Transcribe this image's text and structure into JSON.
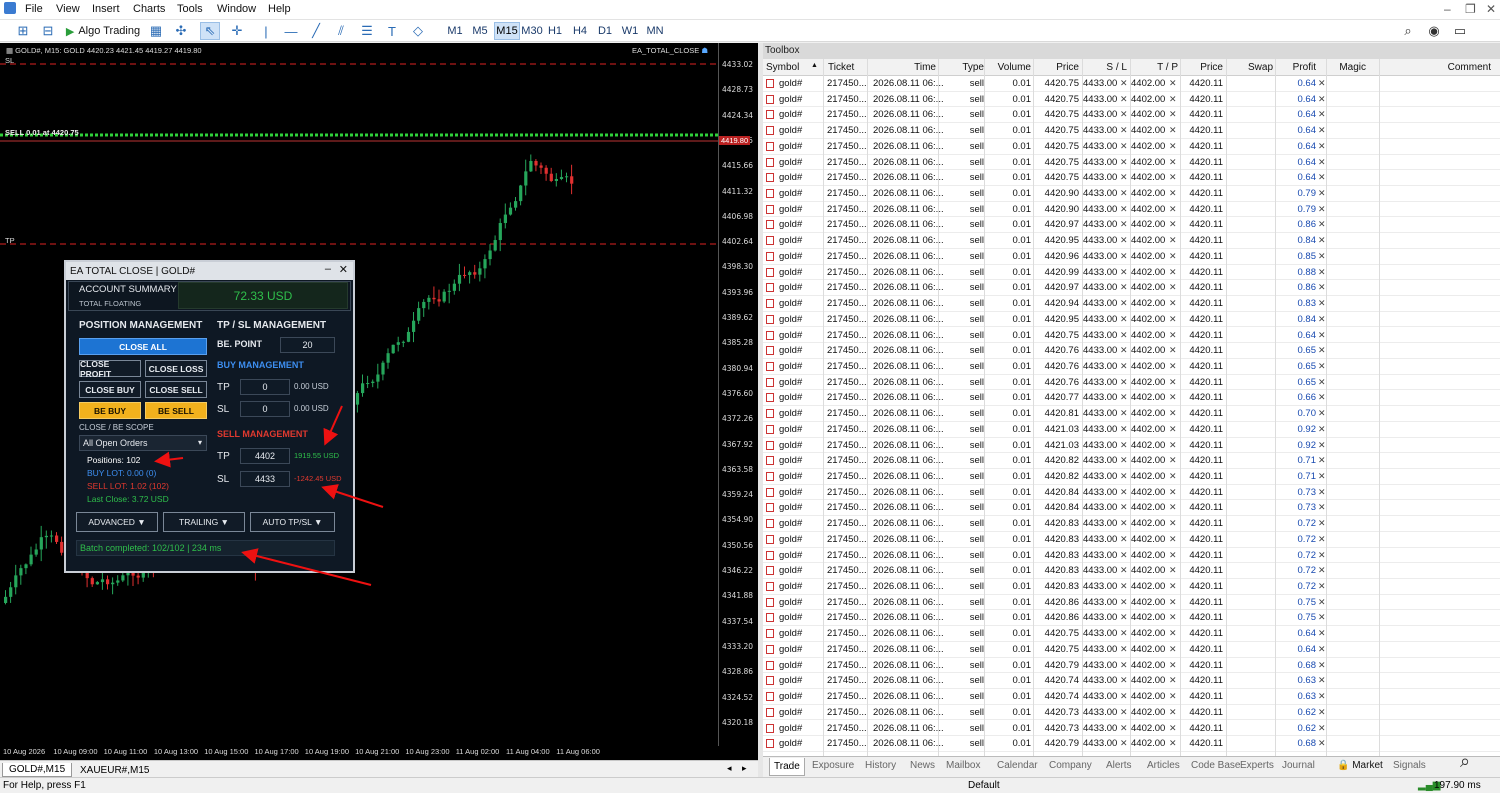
{
  "menu": [
    "File",
    "View",
    "Insert",
    "Charts",
    "Tools",
    "Window",
    "Help"
  ],
  "toolbar": {
    "algo_label": "Algo Trading",
    "timeframes": [
      "M1",
      "M5",
      "M15",
      "M30",
      "H1",
      "H4",
      "D1",
      "W1",
      "MN"
    ],
    "active_tf": "M15"
  },
  "chart": {
    "header": "GOLD#, M15:  GOLD  4420.23 4421.45 4419.27 4419.80",
    "ea_label": "EA_TOTAL_CLOSE",
    "sl_label": "SL",
    "tp_label": "TP",
    "sell_label": "SELL 0.01 at 4420.75",
    "current_price": "4419.80",
    "price_ticks": [
      "4433.02",
      "4428.73",
      "4424.34",
      "4419.95",
      "4415.66",
      "4411.32",
      "4406.98",
      "4402.64",
      "4398.30",
      "4393.96",
      "4389.62",
      "4385.28",
      "4380.94",
      "4376.60",
      "4372.26",
      "4367.92",
      "4363.58",
      "4359.24",
      "4354.90",
      "4350.56",
      "4346.22",
      "4341.88",
      "4337.54",
      "4333.20",
      "4328.86",
      "4324.52",
      "4320.18"
    ],
    "time_ticks": [
      "10 Aug 2026",
      "10 Aug 09:00",
      "10 Aug 11:00",
      "10 Aug 13:00",
      "10 Aug 15:00",
      "10 Aug 17:00",
      "10 Aug 19:00",
      "10 Aug 21:00",
      "10 Aug 23:00",
      "11 Aug 02:00",
      "11 Aug 04:00",
      "11 Aug 06:00"
    ],
    "tabs": [
      "GOLD#,M15",
      "XAUEUR#,M15"
    ],
    "colors": {
      "bull": "#26a65b",
      "bear": "#e03030",
      "sl_line": "#d22",
      "tp_line": "#d22",
      "sell_line": "#2fd03a"
    }
  },
  "ea": {
    "title": "EA TOTAL CLOSE  |  GOLD#",
    "account_summary": "ACCOUNT SUMMARY",
    "total_floating": "TOTAL FLOATING",
    "floating_value": "72.33 USD",
    "position_mgmt": "POSITION MANAGEMENT",
    "tpsl_mgmt": "TP / SL MANAGEMENT",
    "close_all": "CLOSE ALL",
    "close_profit": "CLOSE PROFIT",
    "close_loss": "CLOSE LOSS",
    "close_buy": "CLOSE BUY",
    "close_sell": "CLOSE SELL",
    "be_buy": "BE BUY",
    "be_sell": "BE SELL",
    "be_point_label": "BE. POINT",
    "be_point_value": "20",
    "buy_mgmt": "BUY MANAGEMENT",
    "buy_tp_label": "TP",
    "buy_tp_value": "0",
    "buy_tp_usd": "0.00 USD",
    "buy_sl_label": "SL",
    "buy_sl_value": "0",
    "buy_sl_usd": "0.00 USD",
    "sell_mgmt": "SELL MANAGEMENT",
    "sell_tp_label": "TP",
    "sell_tp_value": "4402",
    "sell_tp_usd": "1919.55 USD",
    "sell_sl_label": "SL",
    "sell_sl_value": "4433",
    "sell_sl_usd": "-1242.45 USD",
    "scope_label": "CLOSE / BE SCOPE",
    "scope_value": "All Open Orders",
    "positions": "Positions: 102",
    "buy_lot": "BUY LOT: 0.00  (0)",
    "sell_lot": "SELL LOT: 1.02  (102)",
    "last_close": "Last Close: 3.72 USD",
    "advanced": "ADVANCED ▼",
    "trailing": "TRAILING ▼",
    "auto": "AUTO TP/SL ▼",
    "batch": "Batch completed: 102/102 | 234 ms"
  },
  "toolbox": {
    "title": "Toolbox",
    "headers": [
      "Symbol",
      "Ticket",
      "Time",
      "Type",
      "Volume",
      "Price",
      "S / L",
      "T / P",
      "Price",
      "Swap",
      "Profit",
      "Magic",
      "Comment"
    ],
    "rows": [
      [
        "gold#",
        "217450...",
        "2026.08.11 06:...",
        "sell",
        "0.01",
        "4420.75",
        "4433.00",
        "4402.00",
        "4420.11",
        "0.64"
      ],
      [
        "gold#",
        "217450...",
        "2026.08.11 06:...",
        "sell",
        "0.01",
        "4420.75",
        "4433.00",
        "4402.00",
        "4420.11",
        "0.64"
      ],
      [
        "gold#",
        "217450...",
        "2026.08.11 06:...",
        "sell",
        "0.01",
        "4420.75",
        "4433.00",
        "4402.00",
        "4420.11",
        "0.64"
      ],
      [
        "gold#",
        "217450...",
        "2026.08.11 06:...",
        "sell",
        "0.01",
        "4420.75",
        "4433.00",
        "4402.00",
        "4420.11",
        "0.64"
      ],
      [
        "gold#",
        "217450...",
        "2026.08.11 06:...",
        "sell",
        "0.01",
        "4420.75",
        "4433.00",
        "4402.00",
        "4420.11",
        "0.64"
      ],
      [
        "gold#",
        "217450...",
        "2026.08.11 06:...",
        "sell",
        "0.01",
        "4420.75",
        "4433.00",
        "4402.00",
        "4420.11",
        "0.64"
      ],
      [
        "gold#",
        "217450...",
        "2026.08.11 06:...",
        "sell",
        "0.01",
        "4420.75",
        "4433.00",
        "4402.00",
        "4420.11",
        "0.64"
      ],
      [
        "gold#",
        "217450...",
        "2026.08.11 06:...",
        "sell",
        "0.01",
        "4420.90",
        "4433.00",
        "4402.00",
        "4420.11",
        "0.79"
      ],
      [
        "gold#",
        "217450...",
        "2026.08.11 06:...",
        "sell",
        "0.01",
        "4420.90",
        "4433.00",
        "4402.00",
        "4420.11",
        "0.79"
      ],
      [
        "gold#",
        "217450...",
        "2026.08.11 06:...",
        "sell",
        "0.01",
        "4420.97",
        "4433.00",
        "4402.00",
        "4420.11",
        "0.86"
      ],
      [
        "gold#",
        "217450...",
        "2026.08.11 06:...",
        "sell",
        "0.01",
        "4420.95",
        "4433.00",
        "4402.00",
        "4420.11",
        "0.84"
      ],
      [
        "gold#",
        "217450...",
        "2026.08.11 06:...",
        "sell",
        "0.01",
        "4420.96",
        "4433.00",
        "4402.00",
        "4420.11",
        "0.85"
      ],
      [
        "gold#",
        "217450...",
        "2026.08.11 06:...",
        "sell",
        "0.01",
        "4420.99",
        "4433.00",
        "4402.00",
        "4420.11",
        "0.88"
      ],
      [
        "gold#",
        "217450...",
        "2026.08.11 06:...",
        "sell",
        "0.01",
        "4420.97",
        "4433.00",
        "4402.00",
        "4420.11",
        "0.86"
      ],
      [
        "gold#",
        "217450...",
        "2026.08.11 06:...",
        "sell",
        "0.01",
        "4420.94",
        "4433.00",
        "4402.00",
        "4420.11",
        "0.83"
      ],
      [
        "gold#",
        "217450...",
        "2026.08.11 06:...",
        "sell",
        "0.01",
        "4420.95",
        "4433.00",
        "4402.00",
        "4420.11",
        "0.84"
      ],
      [
        "gold#",
        "217450...",
        "2026.08.11 06:...",
        "sell",
        "0.01",
        "4420.75",
        "4433.00",
        "4402.00",
        "4420.11",
        "0.64"
      ],
      [
        "gold#",
        "217450...",
        "2026.08.11 06:...",
        "sell",
        "0.01",
        "4420.76",
        "4433.00",
        "4402.00",
        "4420.11",
        "0.65"
      ],
      [
        "gold#",
        "217450...",
        "2026.08.11 06:...",
        "sell",
        "0.01",
        "4420.76",
        "4433.00",
        "4402.00",
        "4420.11",
        "0.65"
      ],
      [
        "gold#",
        "217450...",
        "2026.08.11 06:...",
        "sell",
        "0.01",
        "4420.76",
        "4433.00",
        "4402.00",
        "4420.11",
        "0.65"
      ],
      [
        "gold#",
        "217450...",
        "2026.08.11 06:...",
        "sell",
        "0.01",
        "4420.77",
        "4433.00",
        "4402.00",
        "4420.11",
        "0.66"
      ],
      [
        "gold#",
        "217450...",
        "2026.08.11 06:...",
        "sell",
        "0.01",
        "4420.81",
        "4433.00",
        "4402.00",
        "4420.11",
        "0.70"
      ],
      [
        "gold#",
        "217450...",
        "2026.08.11 06:...",
        "sell",
        "0.01",
        "4421.03",
        "4433.00",
        "4402.00",
        "4420.11",
        "0.92"
      ],
      [
        "gold#",
        "217450...",
        "2026.08.11 06:...",
        "sell",
        "0.01",
        "4421.03",
        "4433.00",
        "4402.00",
        "4420.11",
        "0.92"
      ],
      [
        "gold#",
        "217450...",
        "2026.08.11 06:...",
        "sell",
        "0.01",
        "4420.82",
        "4433.00",
        "4402.00",
        "4420.11",
        "0.71"
      ],
      [
        "gold#",
        "217450...",
        "2026.08.11 06:...",
        "sell",
        "0.01",
        "4420.82",
        "4433.00",
        "4402.00",
        "4420.11",
        "0.71"
      ],
      [
        "gold#",
        "217450...",
        "2026.08.11 06:...",
        "sell",
        "0.01",
        "4420.84",
        "4433.00",
        "4402.00",
        "4420.11",
        "0.73"
      ],
      [
        "gold#",
        "217450...",
        "2026.08.11 06:...",
        "sell",
        "0.01",
        "4420.84",
        "4433.00",
        "4402.00",
        "4420.11",
        "0.73"
      ],
      [
        "gold#",
        "217450...",
        "2026.08.11 06:...",
        "sell",
        "0.01",
        "4420.83",
        "4433.00",
        "4402.00",
        "4420.11",
        "0.72"
      ],
      [
        "gold#",
        "217450...",
        "2026.08.11 06:...",
        "sell",
        "0.01",
        "4420.83",
        "4433.00",
        "4402.00",
        "4420.11",
        "0.72"
      ],
      [
        "gold#",
        "217450...",
        "2026.08.11 06:...",
        "sell",
        "0.01",
        "4420.83",
        "4433.00",
        "4402.00",
        "4420.11",
        "0.72"
      ],
      [
        "gold#",
        "217450...",
        "2026.08.11 06:...",
        "sell",
        "0.01",
        "4420.83",
        "4433.00",
        "4402.00",
        "4420.11",
        "0.72"
      ],
      [
        "gold#",
        "217450...",
        "2026.08.11 06:...",
        "sell",
        "0.01",
        "4420.83",
        "4433.00",
        "4402.00",
        "4420.11",
        "0.72"
      ],
      [
        "gold#",
        "217450...",
        "2026.08.11 06:...",
        "sell",
        "0.01",
        "4420.86",
        "4433.00",
        "4402.00",
        "4420.11",
        "0.75"
      ],
      [
        "gold#",
        "217450...",
        "2026.08.11 06:...",
        "sell",
        "0.01",
        "4420.86",
        "4433.00",
        "4402.00",
        "4420.11",
        "0.75"
      ],
      [
        "gold#",
        "217450...",
        "2026.08.11 06:...",
        "sell",
        "0.01",
        "4420.75",
        "4433.00",
        "4402.00",
        "4420.11",
        "0.64"
      ],
      [
        "gold#",
        "217450...",
        "2026.08.11 06:...",
        "sell",
        "0.01",
        "4420.75",
        "4433.00",
        "4402.00",
        "4420.11",
        "0.64"
      ],
      [
        "gold#",
        "217450...",
        "2026.08.11 06:...",
        "sell",
        "0.01",
        "4420.79",
        "4433.00",
        "4402.00",
        "4420.11",
        "0.68"
      ],
      [
        "gold#",
        "217450...",
        "2026.08.11 06:...",
        "sell",
        "0.01",
        "4420.74",
        "4433.00",
        "4402.00",
        "4420.11",
        "0.63"
      ],
      [
        "gold#",
        "217450...",
        "2026.08.11 06:...",
        "sell",
        "0.01",
        "4420.74",
        "4433.00",
        "4402.00",
        "4420.11",
        "0.63"
      ],
      [
        "gold#",
        "217450...",
        "2026.08.11 06:...",
        "sell",
        "0.01",
        "4420.73",
        "4433.00",
        "4402.00",
        "4420.11",
        "0.62"
      ],
      [
        "gold#",
        "217450...",
        "2026.08.11 06:...",
        "sell",
        "0.01",
        "4420.73",
        "4433.00",
        "4402.00",
        "4420.11",
        "0.62"
      ],
      [
        "gold#",
        "217450...",
        "2026.08.11 06:...",
        "sell",
        "0.01",
        "4420.79",
        "4433.00",
        "4402.00",
        "4420.11",
        "0.68"
      ]
    ],
    "tabs": [
      "Trade",
      "Exposure",
      "History",
      "News",
      "Mailbox",
      "Calendar",
      "Company",
      "Alerts",
      "Articles",
      "Code Base",
      "Experts",
      "Journal",
      "Market",
      "Signals"
    ],
    "active_tab": "Trade"
  },
  "status": {
    "help": "For Help, press F1",
    "profile": "Default",
    "ping": "197.90 ms"
  }
}
